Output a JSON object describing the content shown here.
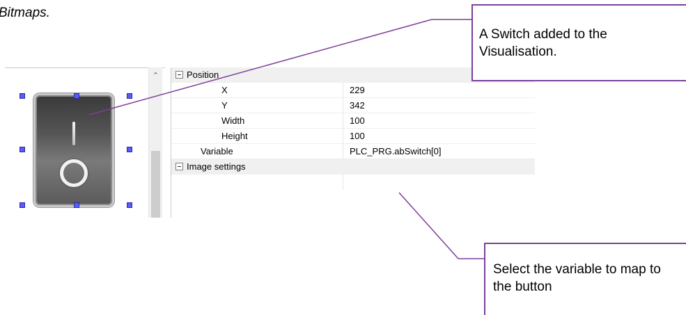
{
  "document": {
    "text_fragment": "Bitmaps."
  },
  "editor": {
    "switch_element_icon": "toggle-switch-icon",
    "handle_color": "#5a5aff",
    "scroll_up_icon": "chevron-up-icon"
  },
  "properties": {
    "position_section": {
      "label": "Position",
      "rows": [
        {
          "name": "X",
          "value": "229"
        },
        {
          "name": "Y",
          "value": "342"
        },
        {
          "name": "Width",
          "value": "100"
        },
        {
          "name": "Height",
          "value": "100"
        }
      ]
    },
    "variable": {
      "name": "Variable",
      "value": "PLC_PRG.abSwitch[0]"
    },
    "image_settings_section": {
      "label": "Image settings"
    }
  },
  "callouts": {
    "top": "A Switch added to the Visualisation.",
    "bottom": "Select the variable to map to the button",
    "border_color": "#7b3f9a"
  }
}
